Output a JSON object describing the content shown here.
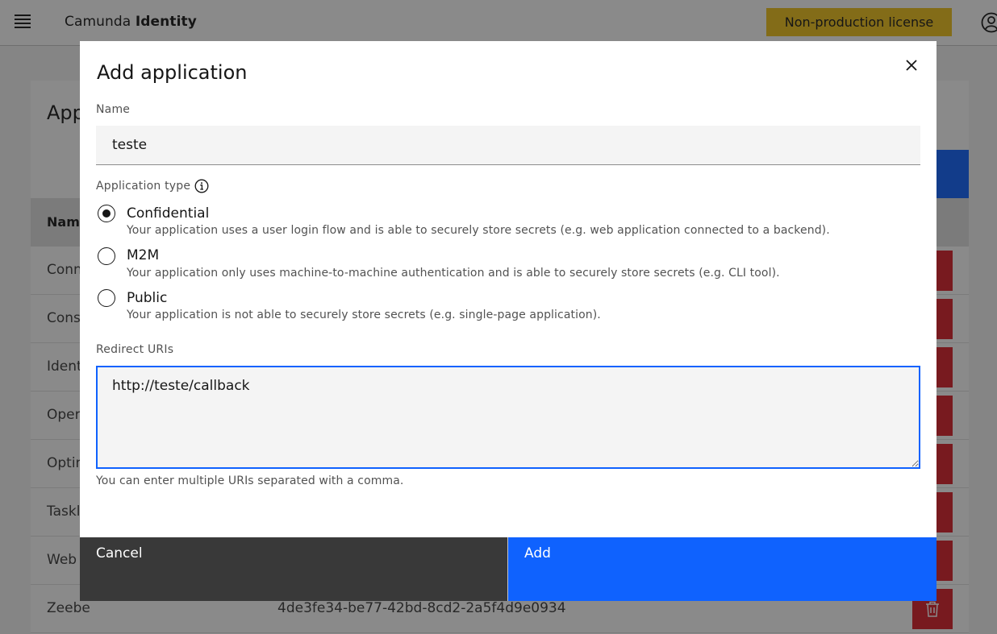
{
  "header": {
    "brand_company": "Camunda",
    "brand_product": "Identity",
    "license_badge": "Non-production license"
  },
  "page": {
    "title_partial": "App",
    "table_header_partial": "Name",
    "rows": [
      {
        "name": "Conn",
        "id": ""
      },
      {
        "name": "Cons",
        "id": ""
      },
      {
        "name": "Ident",
        "id": ""
      },
      {
        "name": "Opera",
        "id": ""
      },
      {
        "name": "Optin",
        "id": ""
      },
      {
        "name": "Taskl",
        "id": ""
      },
      {
        "name": "Web",
        "id": ""
      },
      {
        "name": "Zeebe",
        "id": "4de3fe34-be77-42bd-8cd2-2a5f4d9e0934"
      }
    ]
  },
  "modal": {
    "title": "Add application",
    "name_label": "Name",
    "name_value": "teste",
    "type_label": "Application type",
    "types": [
      {
        "label": "Confidential",
        "description": "Your application uses a user login flow and is able to securely store secrets (e.g. web application connected to a backend).",
        "checked": true
      },
      {
        "label": "M2M",
        "description": "Your application only uses machine-to-machine authentication and is able to securely store secrets (e.g. CLI tool).",
        "checked": false
      },
      {
        "label": "Public",
        "description": "Your application is not able to securely store secrets (e.g. single-page application).",
        "checked": false
      }
    ],
    "redirect_label": "Redirect URIs",
    "redirect_value": "http://teste/callback",
    "redirect_helper": "You can enter multiple URIs separated with a comma.",
    "cancel_label": "Cancel",
    "add_label": "Add"
  },
  "colors": {
    "primary": "#0f62fe",
    "danger": "#da1e28",
    "license": "#f1c21b",
    "secondary_button": "#393939"
  }
}
